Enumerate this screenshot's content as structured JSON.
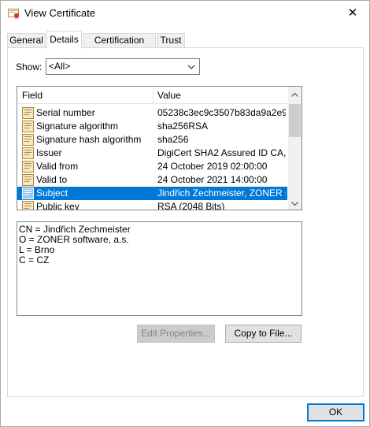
{
  "window": {
    "title": "View Certificate",
    "close_glyph": "✕",
    "title_icon": "certificate-icon"
  },
  "tabs": [
    {
      "label": "General",
      "active": false
    },
    {
      "label": "Details",
      "active": true
    },
    {
      "label": "Certification Path",
      "active": false
    },
    {
      "label": "Trust",
      "active": false
    }
  ],
  "show": {
    "label": "Show:",
    "selected": "<All>"
  },
  "fields_list": {
    "columns": [
      "Field",
      "Value"
    ],
    "rows": [
      {
        "field": "Serial number",
        "value": "05238c3ec9c3507b83da9a2e9...",
        "selected": false
      },
      {
        "field": "Signature algorithm",
        "value": "sha256RSA",
        "selected": false
      },
      {
        "field": "Signature hash algorithm",
        "value": "sha256",
        "selected": false
      },
      {
        "field": "Issuer",
        "value": "DigiCert SHA2 Assured ID CA, ...",
        "selected": false
      },
      {
        "field": "Valid from",
        "value": "24 October 2019 02:00:00",
        "selected": false
      },
      {
        "field": "Valid to",
        "value": "24 October 2021 14:00:00",
        "selected": false
      },
      {
        "field": "Subject",
        "value": "Jindřich Zechmeister, ZONER s...",
        "selected": true
      },
      {
        "field": "Public key",
        "value": "RSA (2048 Bits)",
        "selected": false
      }
    ]
  },
  "detail": {
    "lines": [
      "CN = Jindřich Zechmeister",
      "O = ZONER software, a.s.",
      "L = Brno",
      "C = CZ"
    ]
  },
  "buttons": {
    "edit_properties": "Edit Properties...",
    "copy_to_file": "Copy to File...",
    "ok": "OK"
  },
  "colors": {
    "selection": "#0078d7",
    "default_button_border": "#0078d7"
  }
}
